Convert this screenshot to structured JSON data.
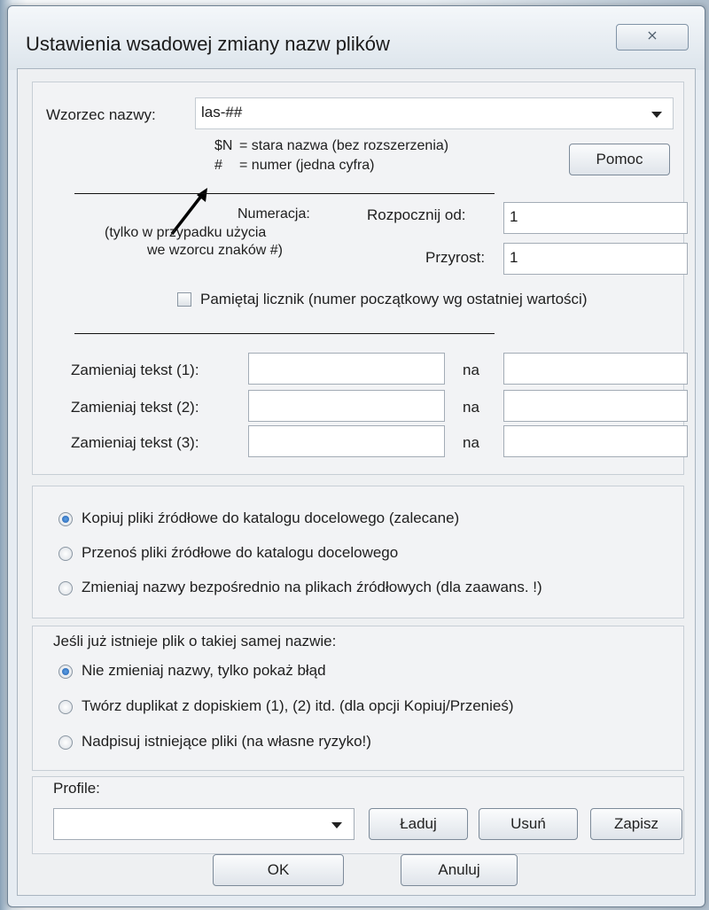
{
  "window": {
    "title": "Ustawienia wsadowej zmiany nazw plików",
    "close_symbol": "⨯"
  },
  "pattern": {
    "label": "Wzorzec nazwy:",
    "value": "las-##",
    "hint_sn_code": "$N",
    "hint_sn_text": "= stara nazwa (bez rozszerzenia)",
    "hint_hash_code": "#",
    "hint_hash_text": "= numer (jedna cyfra)",
    "help_button": "Pomoc"
  },
  "numbering": {
    "label": "Numeracja:",
    "note_line1": "(tylko w przypadku użycia",
    "note_line2": "we wzorcu znaków #)",
    "start_label": "Rozpocznij od:",
    "start_value": "1",
    "step_label": "Przyrost:",
    "step_value": "1",
    "remember_label": "Pamiętaj licznik (numer początkowy wg ostatniej wartości)"
  },
  "replace": {
    "rows": [
      {
        "label": "Zamieniaj tekst (1):",
        "na": "na"
      },
      {
        "label": "Zamieniaj tekst (2):",
        "na": "na"
      },
      {
        "label": "Zamieniaj tekst (3):",
        "na": "na"
      }
    ]
  },
  "mode": {
    "options": [
      {
        "label": "Kopiuj pliki źródłowe do katalogu docelowego (zalecane)",
        "selected": true
      },
      {
        "label": "Przenoś pliki źródłowe do katalogu docelowego",
        "selected": false
      },
      {
        "label": "Zmieniaj nazwy bezpośrednio na plikach źródłowych  (dla zaawans. !)",
        "selected": false
      }
    ]
  },
  "conflict": {
    "heading": "Jeśli już istnieje plik o takiej samej nazwie:",
    "options": [
      {
        "label": "Nie zmieniaj nazwy, tylko pokaż błąd",
        "selected": true
      },
      {
        "label": "Twórz duplikat z dopiskiem (1), (2) itd.  (dla opcji Kopiuj/Przenieś)",
        "selected": false
      },
      {
        "label": "Nadpisuj istniejące pliki  (na własne ryzyko!)",
        "selected": false
      }
    ]
  },
  "profile": {
    "label": "Profile:",
    "load": "Ładuj",
    "delete": "Usuń",
    "save": "Zapisz"
  },
  "footer": {
    "ok": "OK",
    "cancel": "Anuluj"
  }
}
